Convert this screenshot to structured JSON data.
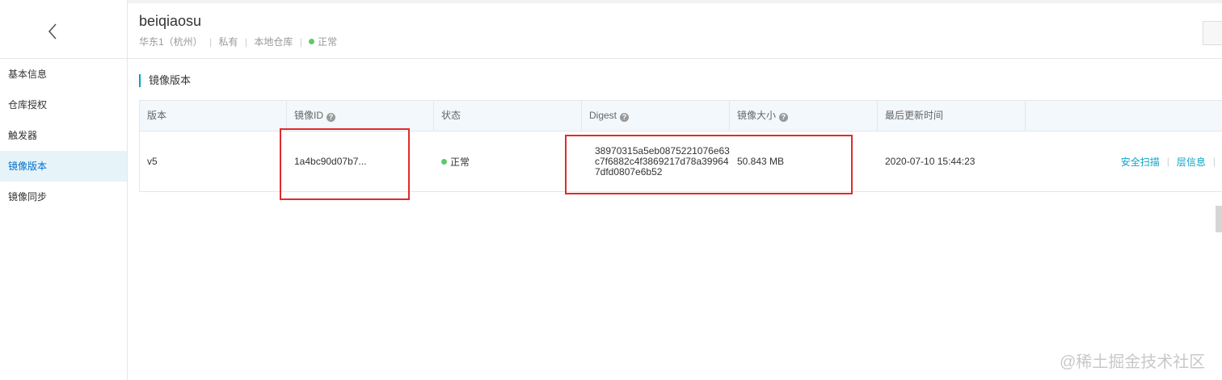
{
  "header": {
    "repo_name": "beiqiaosu",
    "region": "华东1（杭州）",
    "visibility": "私有",
    "repo_type": "本地仓库",
    "status": "正常",
    "meta_separator": "|"
  },
  "sidebar": {
    "items": [
      {
        "label": "基本信息"
      },
      {
        "label": "仓库授权"
      },
      {
        "label": "触发器"
      },
      {
        "label": "镜像版本"
      },
      {
        "label": "镜像同步"
      }
    ]
  },
  "section": {
    "title": "镜像版本"
  },
  "table": {
    "columns": [
      "版本",
      "镜像ID",
      "状态",
      "Digest",
      "镜像大小",
      "最后更新时间"
    ],
    "rows": [
      {
        "version": "v5",
        "image_id": "1a4bc90d07b7...",
        "status": "正常",
        "digest": "38970315a5eb0875221076e63c7f6882c4f3869217d78a399647dfd0807e6b52",
        "size": "50.843 MB",
        "updated": "2020-07-10 15:44:23",
        "actions": [
          "安全扫描",
          "层信息"
        ]
      }
    ]
  },
  "watermark": "@稀土掘金技术社区",
  "colors": {
    "accent": "#00a2ca",
    "link": "#0aa3c9",
    "status_ok": "#5fc86a",
    "highlight": "#e02b2b",
    "brand": "#ff6a00"
  }
}
